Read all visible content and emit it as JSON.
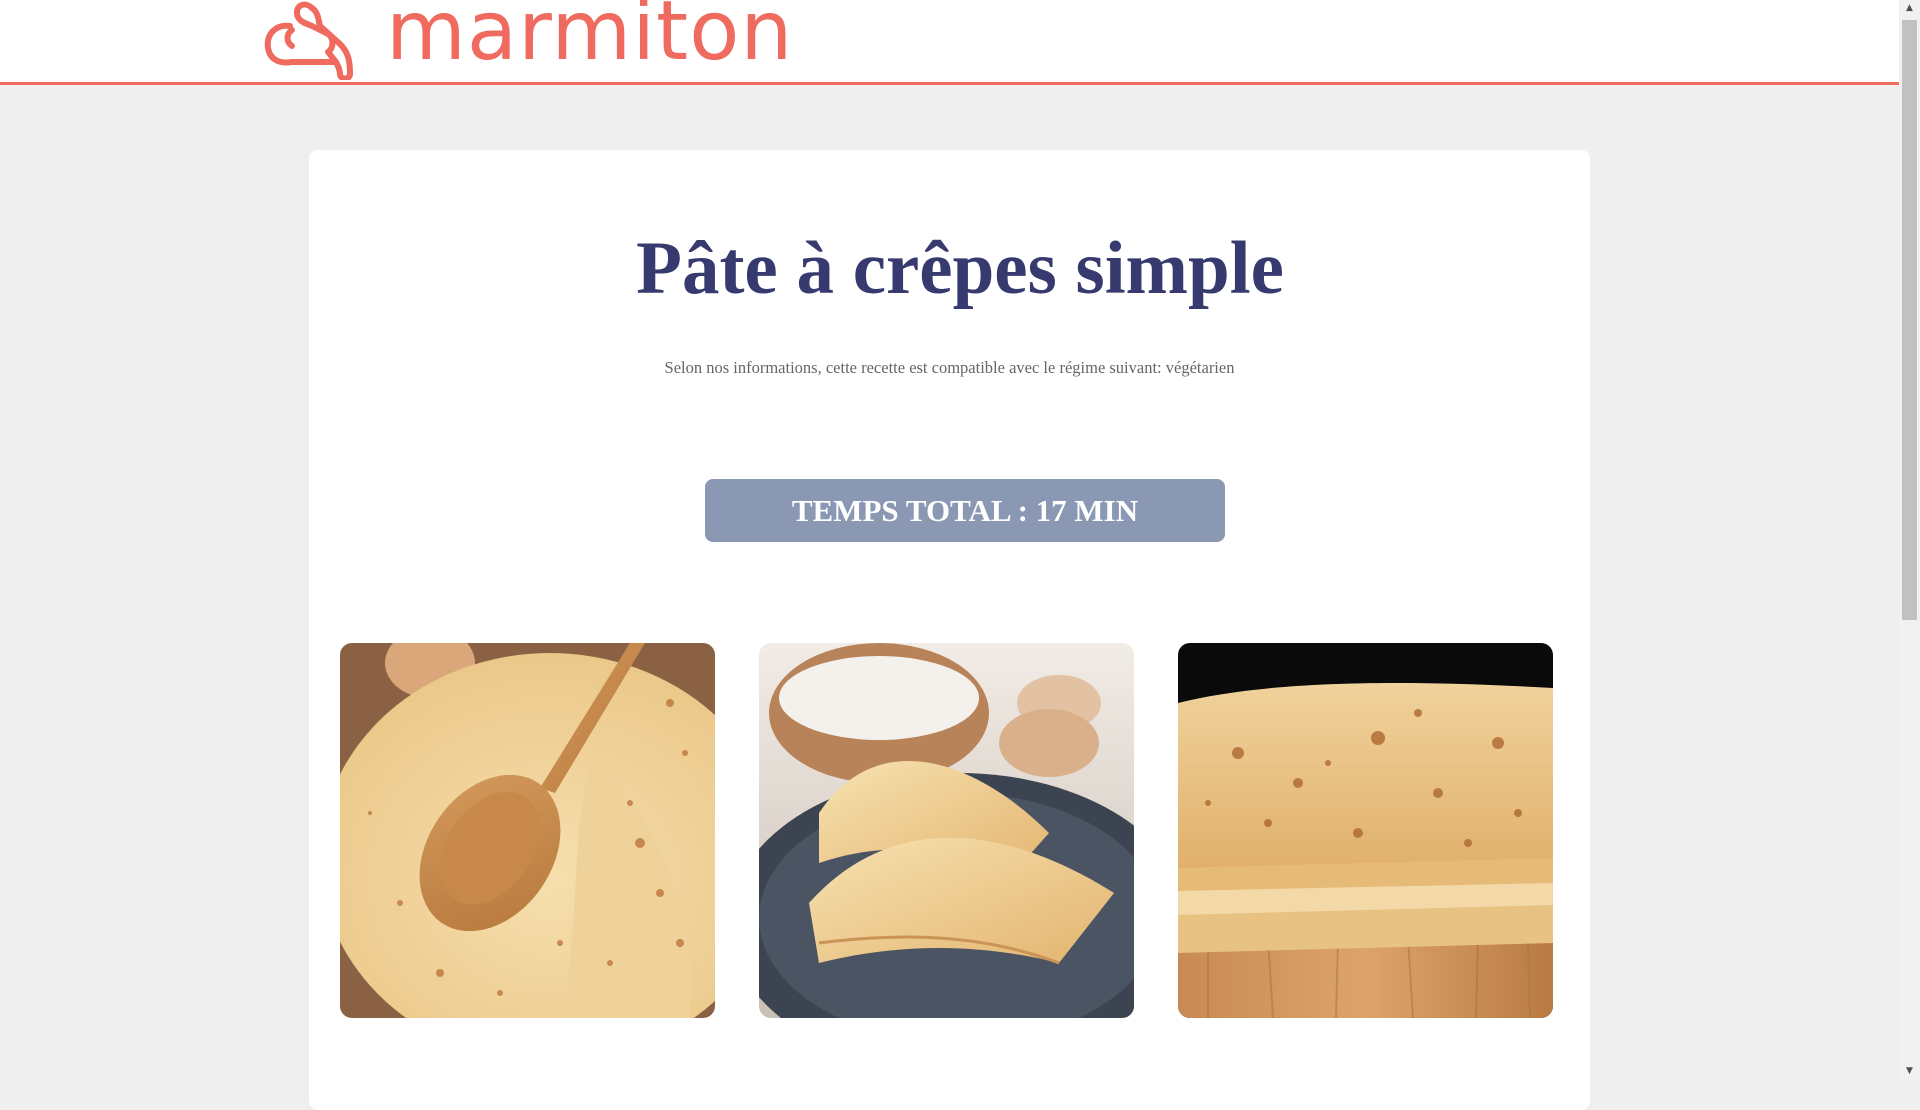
{
  "header": {
    "logo_text": "marmiton",
    "logo_icon": "chef-hat-icon",
    "brand_color": "#ef6a5f"
  },
  "recipe": {
    "title": "Pâte à crêpes simple",
    "diet_note": "Selon nos informations, cette recette est compatible avec le régime suivant: végétarien",
    "total_time": "TEMPS TOTAL : 17 MIN",
    "title_color": "#373a6e",
    "time_badge_color": "#8b98b3"
  },
  "photos": [
    {
      "icon": "crepes-wooden-spoon-photo"
    },
    {
      "icon": "folded-crepes-plate-photo"
    },
    {
      "icon": "crepes-stack-board-photo"
    }
  ]
}
